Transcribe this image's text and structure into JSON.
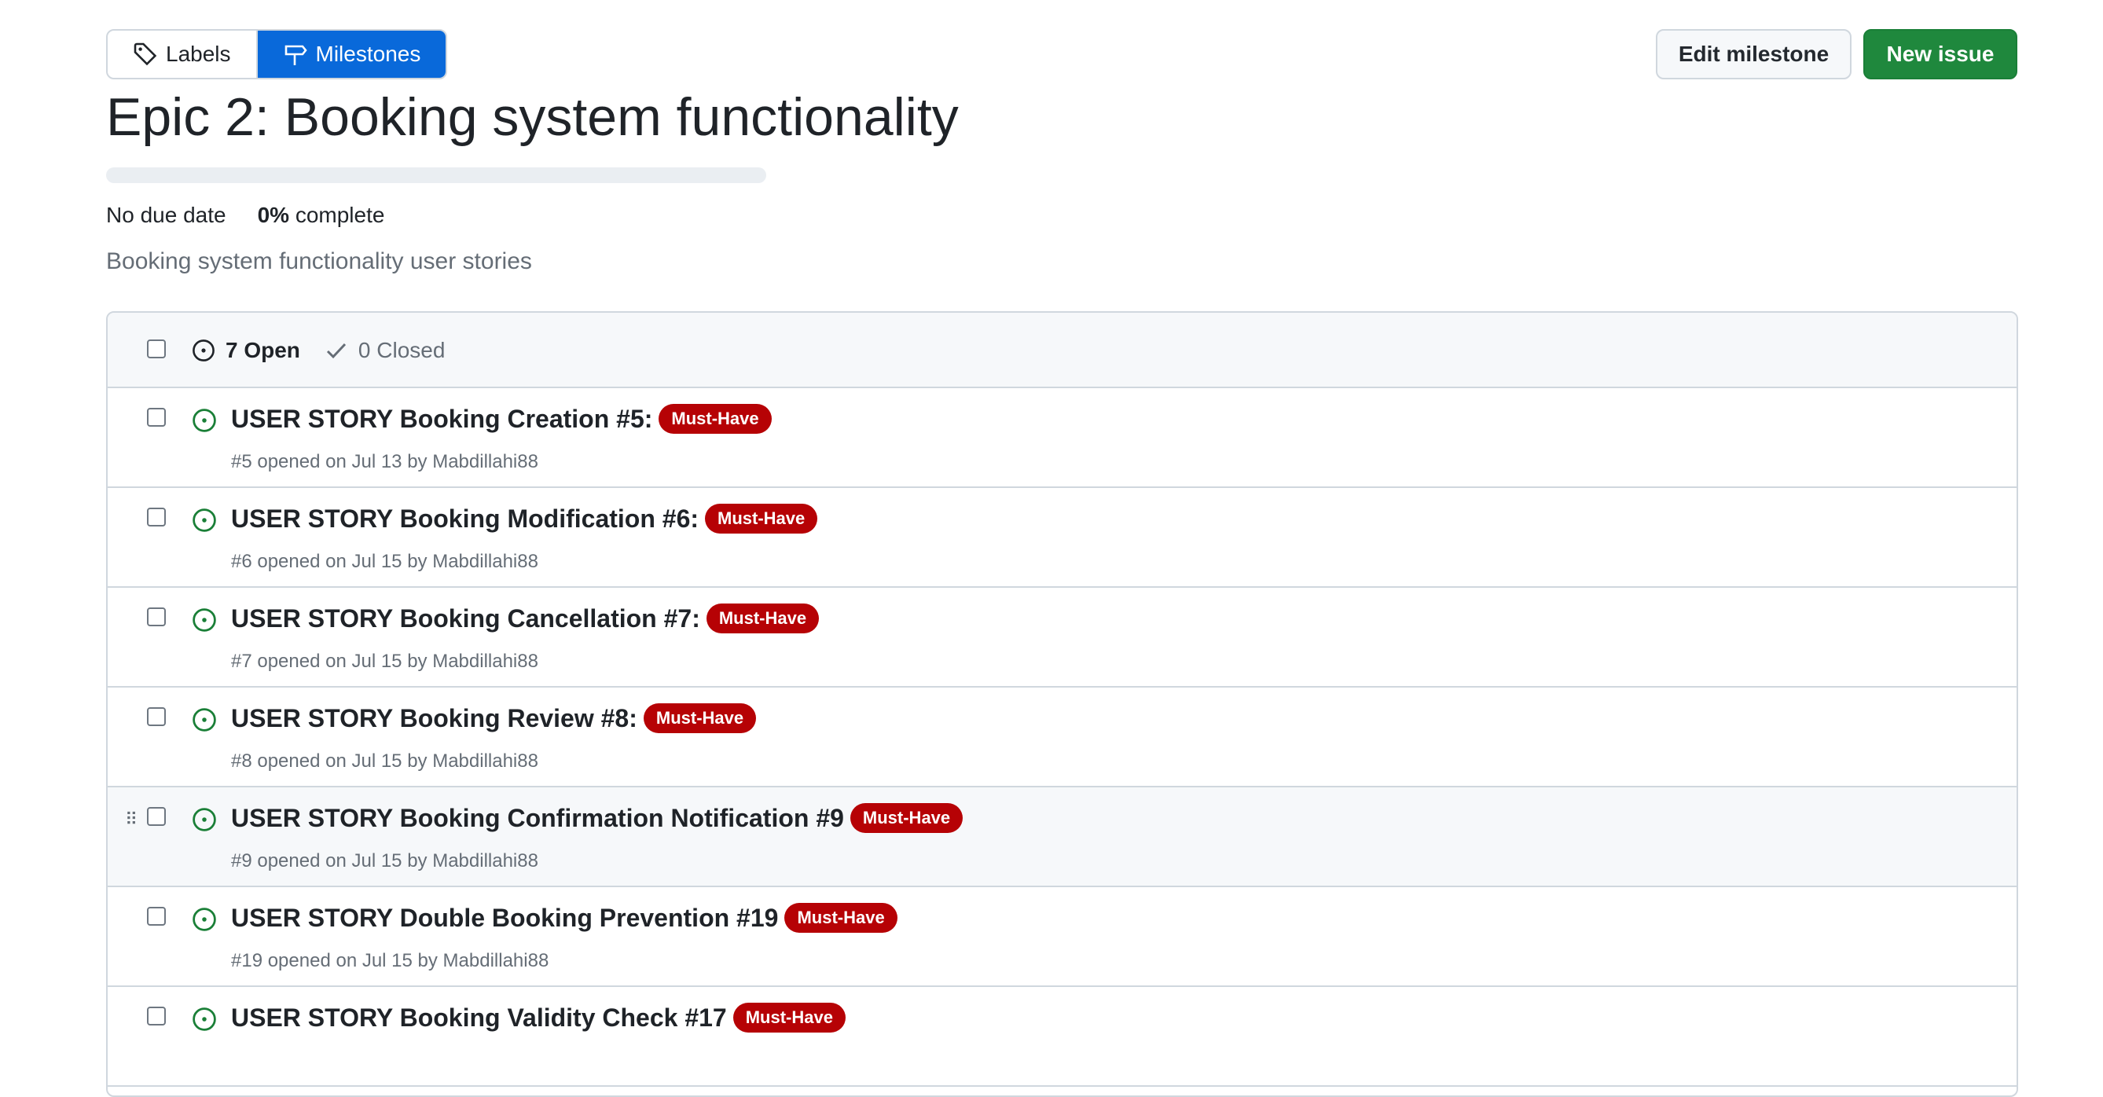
{
  "subnav": {
    "labels": "Labels",
    "milestones": "Milestones"
  },
  "actions": {
    "edit_milestone": "Edit milestone",
    "new_issue": "New issue"
  },
  "milestone": {
    "title": "Epic 2: Booking system functionality",
    "due": "No due date",
    "percent": "0%",
    "complete_word": "complete",
    "progress": 0,
    "description": "Booking system functionality user stories"
  },
  "states": {
    "open": "7 Open",
    "closed": "0 Closed"
  },
  "issues": [
    {
      "title": "USER STORY Booking Creation #5:",
      "label": "Must-Have",
      "meta": "#5 opened on Jul 13 by Mabdillahi88"
    },
    {
      "title": "USER STORY Booking Modification #6:",
      "label": "Must-Have",
      "meta": "#6 opened on Jul 15 by Mabdillahi88"
    },
    {
      "title": "USER STORY Booking Cancellation #7:",
      "label": "Must-Have",
      "meta": "#7 opened on Jul 15 by Mabdillahi88"
    },
    {
      "title": "USER STORY Booking Review #8:",
      "label": "Must-Have",
      "meta": "#8 opened on Jul 15 by Mabdillahi88"
    },
    {
      "title": "USER STORY Booking Confirmation Notification #9",
      "label": "Must-Have",
      "meta": "#9 opened on Jul 15 by Mabdillahi88"
    },
    {
      "title": "USER STORY Double Booking Prevention #19",
      "label": "Must-Have",
      "meta": "#19 opened on Jul 15 by Mabdillahi88"
    },
    {
      "title": "USER STORY Booking Validity Check #17",
      "label": "Must-Have",
      "meta": ""
    }
  ],
  "colors": {
    "primary_button": "#1f883d",
    "selected_tab": "#0969da",
    "label_must_have": "#b60205",
    "open_icon": "#1a7f37"
  }
}
